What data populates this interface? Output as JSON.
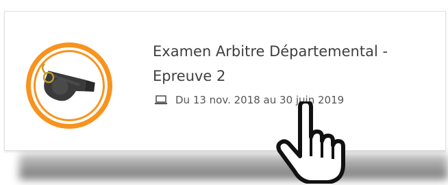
{
  "card": {
    "title": "Examen Arbitre Départemental - Epreuve 2",
    "dates": "Du 13 nov. 2018 au 30 juin 2019",
    "thumbnail_icon": "whistle-icon",
    "date_icon": "laptop-icon"
  },
  "pointer": {
    "icon": "hand-pointer-icon"
  },
  "colors": {
    "ring": "#f7931e",
    "title_text": "#3f3f3f",
    "meta_text": "#555555"
  }
}
